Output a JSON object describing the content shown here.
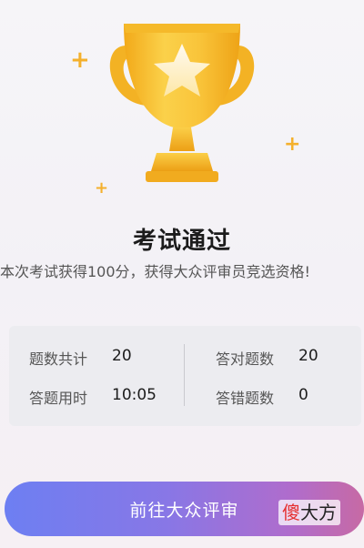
{
  "result": {
    "title": "考试通过",
    "description": "本次考试获得100分，获得大众评审员竞选资格!"
  },
  "stats": {
    "total_label": "题数共计",
    "total_value": "20",
    "correct_label": "答对题数",
    "correct_value": "20",
    "time_label": "答题用时",
    "time_value": "10:05",
    "wrong_label": "答错题数",
    "wrong_value": "0"
  },
  "cta": {
    "label": "前往大众评审"
  },
  "watermark": {
    "accent": "傻",
    "rest": "大方"
  },
  "colors": {
    "trophy_gold": "#f7c331",
    "sparkle": "#f4b02c",
    "button_start": "#6d7ff2",
    "button_end": "#c76aa4"
  },
  "icons": {
    "trophy": "trophy-icon",
    "sparkle": "sparkle-icon"
  }
}
